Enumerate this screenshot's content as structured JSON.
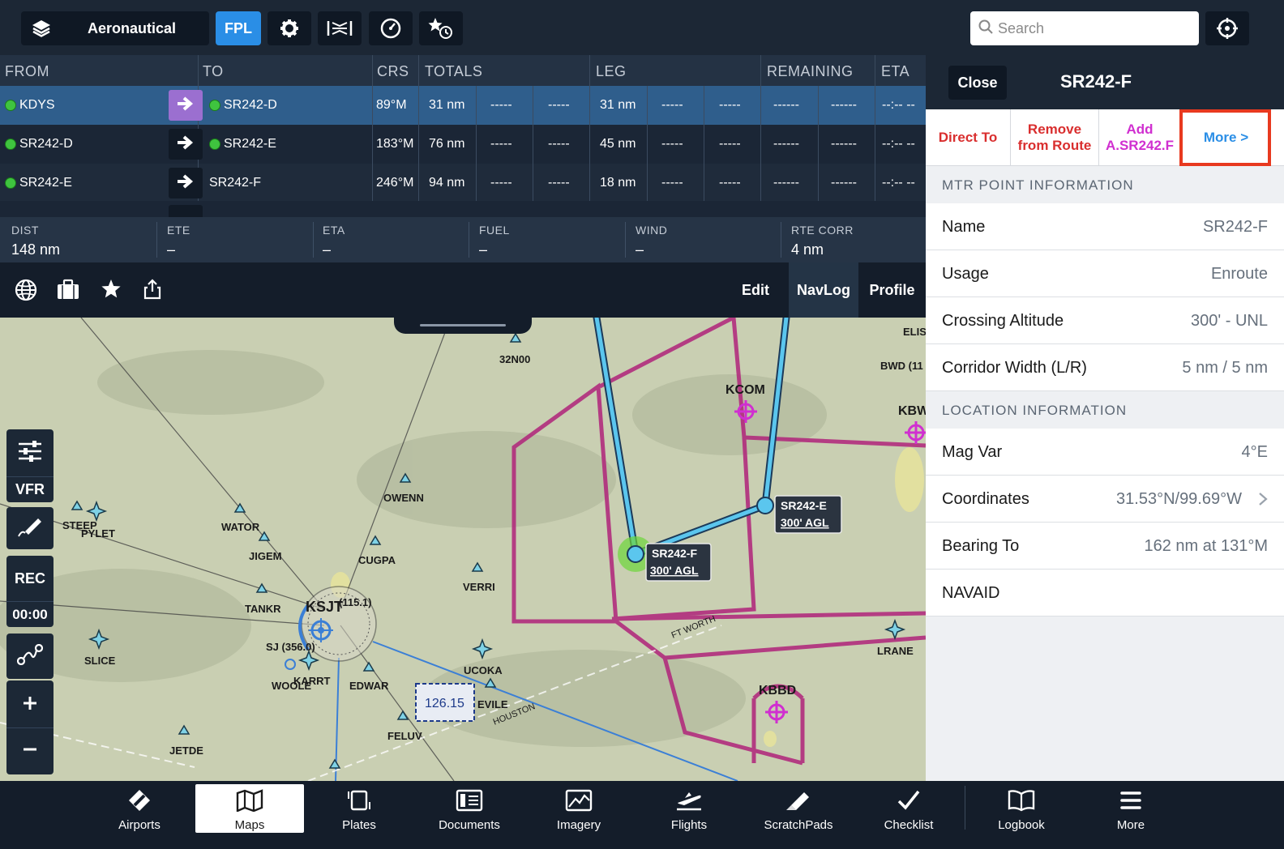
{
  "toolbar": {
    "layers_label": "Aeronautical",
    "fpl_label": "FPL",
    "search_placeholder": "Search"
  },
  "navlog": {
    "headers": [
      "FROM",
      "TO",
      "CRS",
      "TOTALS",
      "LEG",
      "REMAINING",
      "ETA"
    ],
    "rows": [
      {
        "from": "KDYS",
        "from_dot": true,
        "to": "SR242-D",
        "to_dot": true,
        "crs": "89°M",
        "totals": "31 nm",
        "c1": "-----",
        "c2": "-----",
        "leg": "31 nm",
        "c3": "-----",
        "c4": "-----",
        "c5": "------",
        "c6": "------",
        "eta": "--:-- --",
        "selected": true
      },
      {
        "from": "SR242-D",
        "from_dot": true,
        "to": "SR242-E",
        "to_dot": true,
        "crs": "183°M",
        "totals": "76 nm",
        "c1": "-----",
        "c2": "-----",
        "leg": "45 nm",
        "c3": "-----",
        "c4": "-----",
        "c5": "------",
        "c6": "------",
        "eta": "--:-- --",
        "selected": false
      },
      {
        "from": "SR242-E",
        "from_dot": true,
        "to": "SR242-F",
        "to_dot": false,
        "crs": "246°M",
        "totals": "94 nm",
        "c1": "-----",
        "c2": "-----",
        "leg": "18 nm",
        "c3": "-----",
        "c4": "-----",
        "c5": "------",
        "c6": "------",
        "eta": "--:-- --",
        "selected": false
      }
    ],
    "totals": [
      {
        "label": "DIST",
        "value": "148 nm"
      },
      {
        "label": "ETE",
        "value": "–"
      },
      {
        "label": "ETA",
        "value": "–"
      },
      {
        "label": "FUEL",
        "value": "–"
      },
      {
        "label": "WIND",
        "value": "–"
      },
      {
        "label": "RTE CORR",
        "value": "4 nm"
      }
    ],
    "tabs": {
      "edit": "Edit",
      "navlog": "NavLog",
      "profile": "Profile"
    }
  },
  "map": {
    "tools": {
      "vfr": "VFR",
      "rec": "REC",
      "timer": "00:00"
    },
    "labels": {
      "n32": "32N00",
      "elis": "ELIS",
      "bwd": "BWD (11",
      "kbw": "KBW",
      "kcom": "KCOM",
      "owenn": "OWENN",
      "steep": "STEEP",
      "pylet": "PYLET",
      "wator": "WATOR",
      "jigem": "JIGEM",
      "cugpa": "CUGPA",
      "verri": "VERRI",
      "tankr": "TANKR",
      "ksjt": "KSJT",
      "ksjt_freq": "(115.1)",
      "sj": "SJ (356.0)",
      "slice": "SLICE",
      "woole": "WOOLE",
      "karrt": "KARRT",
      "edwar": "EDWAR",
      "ucoka": "UCOKA",
      "evile": "EVILE",
      "freq": "126.15",
      "feluv": "FELUV",
      "houston": "HOUSTON",
      "ftworth": "FT WORTH",
      "jetde": "JETDE",
      "lrane": "LRANE",
      "kbbd": "KBBD",
      "sr242e": "SR242-E",
      "sr242e_alt": "300' AGL",
      "sr242f": "SR242-F",
      "sr242f_alt": "300' AGL"
    }
  },
  "panel": {
    "close": "Close",
    "title": "SR242-F",
    "actions": {
      "direct": "Direct To",
      "remove1": "Remove",
      "remove2": "from Route",
      "add1": "Add",
      "add2": "A.SR242.F",
      "more": "More >"
    },
    "section1": "MTR POINT INFORMATION",
    "mtr_rows": [
      {
        "k": "Name",
        "v": "SR242-F"
      },
      {
        "k": "Usage",
        "v": "Enroute"
      },
      {
        "k": "Crossing Altitude",
        "v": "300' - UNL"
      },
      {
        "k": "Corridor Width (L/R)",
        "v": "5 nm / 5 nm"
      }
    ],
    "section2": "LOCATION INFORMATION",
    "loc_rows": [
      {
        "k": "Mag Var",
        "v": "4°E"
      },
      {
        "k": "Coordinates",
        "v": "31.53°N/99.69°W"
      },
      {
        "k": "Bearing To",
        "v": "162 nm at 131°M"
      },
      {
        "k": "NAVAID",
        "v": ""
      }
    ]
  },
  "tabs": [
    "Airports",
    "Maps",
    "Plates",
    "Documents",
    "Imagery",
    "Flights",
    "ScratchPads",
    "Checklist",
    "Logbook",
    "More"
  ],
  "colors": {
    "accent": "#2a8ee6",
    "highlight": "#e8391f",
    "direct": "#d92e2e",
    "add": "#d02fd0",
    "more": "#2a8ee6",
    "route": "#5bc6ee",
    "mtr": "#b0237a"
  }
}
